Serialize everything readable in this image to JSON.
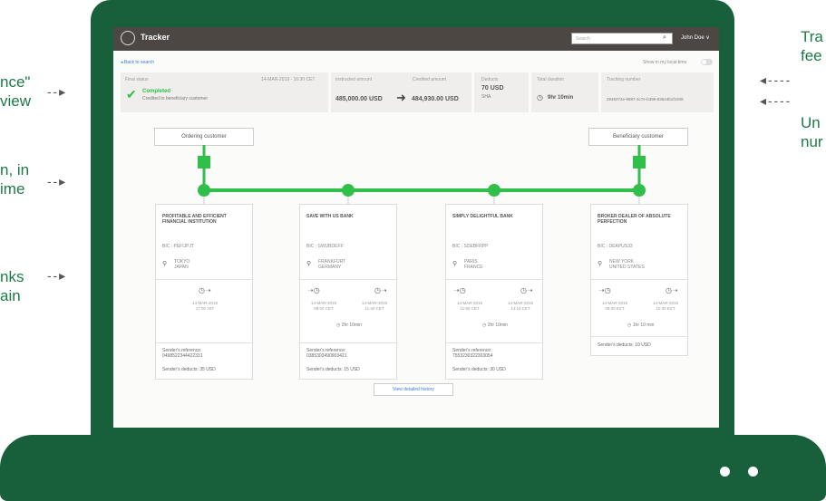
{
  "annotations": {
    "left": [
      {
        "lines": [
          "nce\"",
          "view"
        ]
      },
      {
        "lines": [
          "n, in",
          "ime"
        ]
      },
      {
        "lines": [
          "nks",
          "ain"
        ]
      }
    ],
    "right": [
      {
        "lines": [
          "Tra",
          "fee"
        ]
      },
      {
        "lines": [
          "Un",
          "nur"
        ]
      }
    ]
  },
  "header": {
    "app_title": "Tracker",
    "search_placeholder": "Search",
    "user_menu": "John Doe ∨"
  },
  "toolbar": {
    "back_link": "◂ Back to search",
    "local_time_label": "Show in my local time"
  },
  "status": {
    "label": "Final status",
    "datetime": "14-MAR-2019 - 16:30 CET",
    "value": "Completed",
    "detail": "Credited to beneficiary customer"
  },
  "amounts": {
    "instructed_label": "Instructed amount",
    "instructed_value": "485,000.00 USD",
    "credited_label": "Credited amount",
    "credited_value": "484,930.00 USD"
  },
  "deducts": {
    "label": "Deducts",
    "value": "70 USD",
    "type": "SHA"
  },
  "duration": {
    "label": "Total duration",
    "value": "9hr 10min"
  },
  "tracking": {
    "label": "Tracking number",
    "value": "2948372e-6697-4c7e-b399-83644b1f1948"
  },
  "customers": {
    "ordering": "Ordering customer",
    "beneficiary": "Beneficiary customer"
  },
  "banks": [
    {
      "name": "PROFITABLE AND EFFICIENT FINANCIAL INSTITUTION",
      "bic": "BIC : PEFIJPJT",
      "city": "TOKYO",
      "country": "JAPAN",
      "out_time": "14-MAR-2019 17:00 JST",
      "ref_label": "Sender's reference:",
      "ref_value": "0498522344422331",
      "deduct": "Sender's deducts: 35 USD"
    },
    {
      "name": "SAVE WITH US BANK",
      "bic": "BIC : SWUBDEFF",
      "city": "FRANKFURT",
      "country": "GERMANY",
      "in_time": "14-MAR-2019 09:00 CET",
      "out_time": "14-MAR-2019 11:40 CET",
      "dur": "2hr 10min",
      "ref_label": "Sender's reference:",
      "ref_value": "0385303490903421",
      "deduct": "Sender's deducts: 15 USD"
    },
    {
      "name": "SIMPLY DELIGHTFUL BANK",
      "bic": "BIC : SDEBFRPP",
      "city": "PARIS",
      "country": "FRANCE",
      "in_time": "14-MAR-2019 11:50 CET",
      "out_time": "14-MAR-2019 14:10 CET",
      "dur": "2hr 10min",
      "ref_label": "Sender's reference:",
      "ref_value": "7553230322303054",
      "deduct": "Sender's deducts: 30 USD"
    },
    {
      "name": "BROKER DEALER OF ABSOLUTE PERFECTION",
      "bic": "BIC : DEAPUS33",
      "city": "NEW YORK",
      "country": "UNITED STATES",
      "in_time": "14-MAR-2019 09:20 EST",
      "out_time": "14-MAR-2019 10:30 EST",
      "dur": "1hr 10 min",
      "deduct": "Sender's deducts: 10 USD"
    }
  ],
  "history_button": "View detailed history",
  "colors": {
    "laptop": "#185f3c",
    "accent_green": "#2fbf4a",
    "header": "#4d4743"
  }
}
